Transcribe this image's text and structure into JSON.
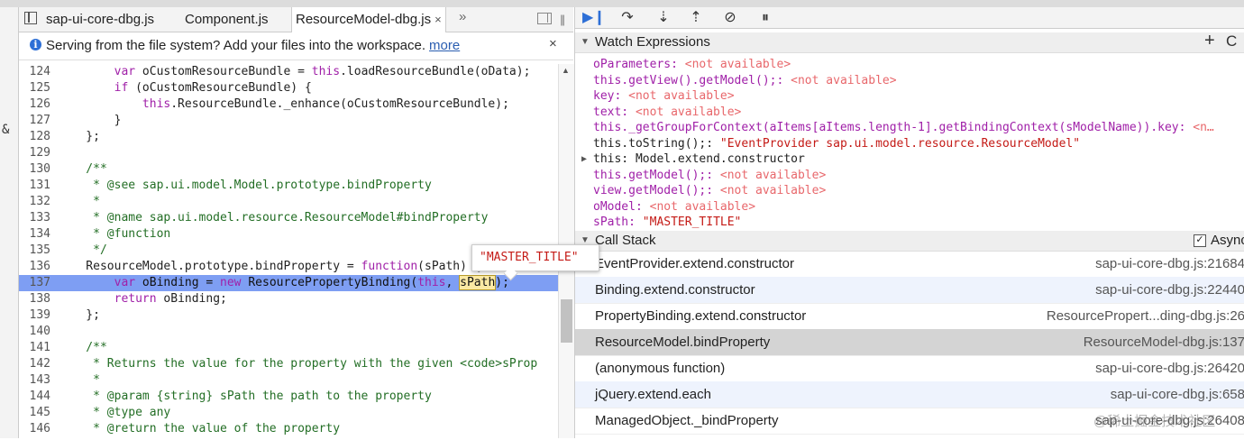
{
  "editor": {
    "tabs": [
      {
        "label": "sap-ui-core-dbg.js"
      },
      {
        "label": "Component.js"
      },
      {
        "label": "ResourceModel-dbg.js",
        "close": "×"
      }
    ],
    "more_tabs": "»",
    "infobar": {
      "text": "Serving from the file system? Add your files into the workspace.",
      "link": "more",
      "close": "×"
    },
    "lines": [
      {
        "n": "124",
        "code": "        var oCustomResourceBundle = this.loadResourceBundle(oData);"
      },
      {
        "n": "125",
        "code": "        if (oCustomResourceBundle) {"
      },
      {
        "n": "126",
        "code": "            this.ResourceBundle._enhance(oCustomResourceBundle);"
      },
      {
        "n": "127",
        "code": "        }"
      },
      {
        "n": "128",
        "code": "    };"
      },
      {
        "n": "129",
        "code": ""
      },
      {
        "n": "130",
        "code": "    /**"
      },
      {
        "n": "131",
        "code": "     * @see sap.ui.model.Model.prototype.bindProperty"
      },
      {
        "n": "132",
        "code": "     *"
      },
      {
        "n": "133",
        "code": "     * @name sap.ui.model.resource.ResourceModel#bindProperty"
      },
      {
        "n": "134",
        "code": "     * @function"
      },
      {
        "n": "135",
        "code": "     */"
      },
      {
        "n": "136",
        "code": "    ResourceModel.prototype.bindProperty = function(sPath) {"
      },
      {
        "n": "137",
        "code": "        var oBinding = new ResourcePropertyBinding(this, sPath);"
      },
      {
        "n": "138",
        "code": "        return oBinding;"
      },
      {
        "n": "139",
        "code": "    };"
      },
      {
        "n": "140",
        "code": ""
      },
      {
        "n": "141",
        "code": "    /**"
      },
      {
        "n": "142",
        "code": "     * Returns the value for the property with the given <code>sProp"
      },
      {
        "n": "143",
        "code": "     *"
      },
      {
        "n": "144",
        "code": "     * @param {string} sPath the path to the property"
      },
      {
        "n": "145",
        "code": "     * @type any"
      },
      {
        "n": "146",
        "code": "     * @return the value of the property"
      }
    ],
    "popover_value": "\"MASTER_TITLE\""
  },
  "left_gutter_char": "&",
  "debugger": {
    "toolbar": {
      "resume_icon": "resume-icon",
      "step_over_icon": "step-over-icon",
      "step_into_icon": "step-into-icon",
      "step_out_icon": "step-out-icon",
      "deactivate_icon": "deactivate-breakpoints-icon",
      "pause_icon": "pause-on-exceptions-icon"
    },
    "watch": {
      "title": "Watch Expressions",
      "add": "+",
      "refresh": "C",
      "items": [
        {
          "expr": "oParameters:",
          "value": "<not available>",
          "kind": "na"
        },
        {
          "expr": "this.getView().getModel();:",
          "value": "<not available>",
          "kind": "na"
        },
        {
          "expr": "key:",
          "value": "<not available>",
          "kind": "na"
        },
        {
          "expr": "text:",
          "value": "<not available>",
          "kind": "na"
        },
        {
          "expr": "this._getGroupForContext(aItems[aItems.length-1].getBindingContext(sModelName)).key:",
          "value": "<n…",
          "kind": "na"
        },
        {
          "expr": "this.toString();:",
          "value": "\"EventProvider sap.ui.model.resource.ResourceModel\"",
          "kind": "str"
        },
        {
          "expr": "this:",
          "value": "Model.extend.constructor",
          "kind": "obj"
        },
        {
          "expr": "this.getModel();:",
          "value": "<not available>",
          "kind": "na"
        },
        {
          "expr": "view.getModel();:",
          "value": "<not available>",
          "kind": "na"
        },
        {
          "expr": "oModel:",
          "value": "<not available>",
          "kind": "na"
        },
        {
          "expr": "sPath:",
          "value": "\"MASTER_TITLE\"",
          "kind": "str"
        }
      ]
    },
    "callstack": {
      "title": "Call Stack",
      "async_label": "Async",
      "async_checked": "✓",
      "frames": [
        {
          "fn": "EventProvider.extend.constructor",
          "loc": "sap-ui-core-dbg.js:21684"
        },
        {
          "fn": "Binding.extend.constructor",
          "loc": "sap-ui-core-dbg.js:22440"
        },
        {
          "fn": "PropertyBinding.extend.constructor",
          "loc": "ResourcePropert...ding-dbg.js:26"
        },
        {
          "fn": "ResourceModel.bindProperty",
          "loc": "ResourceModel-dbg.js:137"
        },
        {
          "fn": "(anonymous function)",
          "loc": "sap-ui-core-dbg.js:26420"
        },
        {
          "fn": "jQuery.extend.each",
          "loc": "sap-ui-core-dbg.js:658"
        },
        {
          "fn": "ManagedObject._bindProperty",
          "loc": "sap-ui-core-dbg.js:26408"
        }
      ]
    }
  },
  "watermark": "@稀土掘金技术社区"
}
